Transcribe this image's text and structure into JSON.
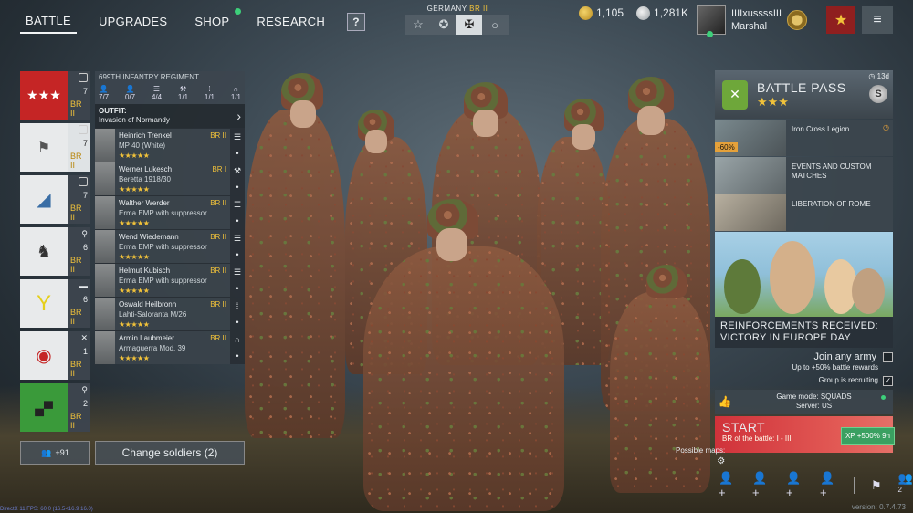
{
  "nav": {
    "tabs": [
      "BATTLE",
      "UPGRADES",
      "SHOP",
      "RESEARCH"
    ],
    "help": "?"
  },
  "nation": {
    "label": "GERMANY",
    "br": "BR II",
    "icons": [
      "star-icon",
      "star-circle-icon",
      "iron-cross-icon",
      "circle-icon"
    ]
  },
  "currency": {
    "gold": "1,105",
    "silver": "1,281K"
  },
  "user": {
    "name": "IIIIxussssIII",
    "rank": "Marshal"
  },
  "squads": [
    {
      "count": "7",
      "br": "BR II"
    },
    {
      "count": "7",
      "br": "BR II"
    },
    {
      "count": "7",
      "br": "BR II"
    },
    {
      "count": "6",
      "br": "BR II"
    },
    {
      "count": "6",
      "br": "BR II"
    },
    {
      "count": "1",
      "br": "BR II"
    },
    {
      "count": "2",
      "br": "BR II"
    }
  ],
  "panel": {
    "regiment": "699TH INFANTRY REGIMENT",
    "stats": [
      "7/7",
      "0/7",
      "4/4",
      "1/1",
      "1/1",
      "1/1"
    ],
    "outfit_label": "OUTFIT:",
    "outfit_value": "Invasion of Normandy",
    "soldiers": [
      {
        "name": "Heinrich Trenkel",
        "br": "BR II",
        "weapon": "MP 40 (White)",
        "stars": "★★★★★"
      },
      {
        "name": "Werner Lukesch",
        "br": "BR I",
        "weapon": "Beretta 1918/30",
        "stars": "★★★★★"
      },
      {
        "name": "Walther Werder",
        "br": "BR II",
        "weapon": "Erma EMP with suppressor",
        "stars": "★★★★★"
      },
      {
        "name": "Wend Wiedemann",
        "br": "BR II",
        "weapon": "Erma EMP with suppressor",
        "stars": "★★★★★"
      },
      {
        "name": "Helmut Kubisch",
        "br": "BR II",
        "weapon": "Erma EMP with suppressor",
        "stars": "★★★★★"
      },
      {
        "name": "Oswald Heilbronn",
        "br": "BR II",
        "weapon": "Lahti-Saloranta M/26",
        "stars": "★★★★★"
      },
      {
        "name": "Armin Laubmeier",
        "br": "BR II",
        "weapon": "Armaguerra Mod. 39",
        "stars": "★★★★★"
      }
    ]
  },
  "recruit": {
    "count": "+91"
  },
  "change": {
    "label": "Change soldiers (2)"
  },
  "battlepass": {
    "title": "BATTLE PASS",
    "stars": "★★★",
    "days": "13d",
    "badge": "S"
  },
  "events": [
    {
      "title": "Iron Cross Legion",
      "discount": "-60%"
    },
    {
      "title": "EVENTS AND CUSTOM MATCHES"
    },
    {
      "title": "LIBERATION OF ROME"
    }
  ],
  "banner": {
    "title": "REINFORCEMENTS RECEIVED: VICTORY IN EUROPE DAY"
  },
  "join": {
    "label": "Join any army",
    "bonus": "Up to +50% battle rewards",
    "recruiting": "Group is recruiting"
  },
  "gamemode": {
    "mode": "Game mode: SQUADS",
    "server": "Server: US"
  },
  "start": {
    "label": "START",
    "br": "BR of the battle: I - III",
    "xp": "+500% 9h",
    "xp_label": "XP"
  },
  "maps": {
    "label": "Possible maps:"
  },
  "group": {
    "count": "2"
  },
  "version": "version: 0.7.4.73",
  "fps": "DirectX 11 FPS: 60.0 (16.5<16.9 16.0)"
}
